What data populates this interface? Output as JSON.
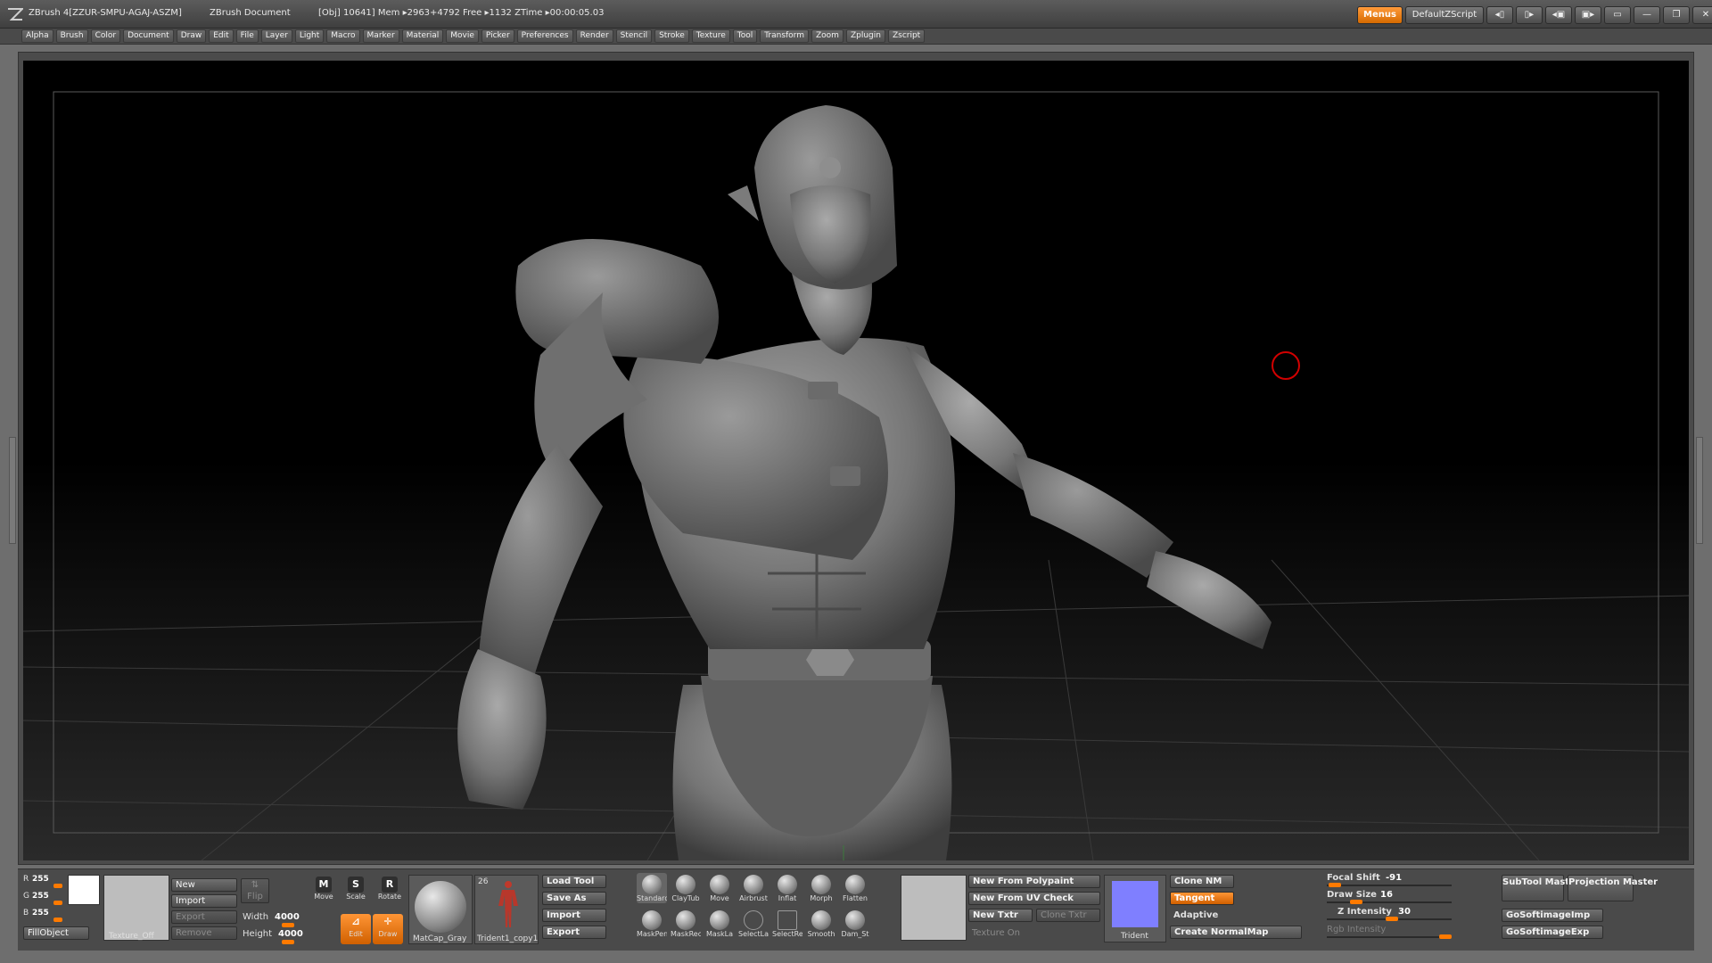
{
  "titlebar": {
    "app": "ZBrush 4[ZZUR-SMPU-AGAJ-ASZM]",
    "document": "ZBrush Document",
    "stats": "[Obj] 10641]  Mem ▸2963+4792  Free ▸1132  ZTime ▸00:00:05.03",
    "menus_toggle": "Menus",
    "default_script": "DefaultZScript"
  },
  "menubar": [
    "Alpha",
    "Brush",
    "Color",
    "Document",
    "Draw",
    "Edit",
    "File",
    "Layer",
    "Light",
    "Macro",
    "Marker",
    "Material",
    "Movie",
    "Picker",
    "Preferences",
    "Render",
    "Stencil",
    "Stroke",
    "Texture",
    "Tool",
    "Transform",
    "Zoom",
    "Zplugin",
    "Zscript"
  ],
  "color": {
    "r_label": "R",
    "r_value": "255",
    "g_label": "G",
    "g_value": "255",
    "b_label": "B",
    "b_value": "255",
    "fill_object": "FillObject"
  },
  "texture_panel": {
    "new": "New",
    "import": "Import",
    "export": "Export",
    "remove": "Remove",
    "texture_off": "Texture_Off",
    "flip": "Flip",
    "width_label": "Width",
    "width_value": "4000",
    "height_label": "Height",
    "height_value": "4000"
  },
  "transform": {
    "move": "Move",
    "scale": "Scale",
    "rotate": "Rotate",
    "edit": "Edit",
    "draw": "Draw"
  },
  "material": {
    "name": "MatCap_Gray"
  },
  "tool": {
    "name": "Trident1_copy1",
    "count": "26"
  },
  "tool_buttons": {
    "load": "Load Tool",
    "save_as": "Save As",
    "import": "Import",
    "export": "Export"
  },
  "brushes": [
    "Standard",
    "ClayTub",
    "Move",
    "Airbrust",
    "Inflat",
    "Morph",
    "Flatten",
    "MaskPen",
    "MaskRec",
    "MaskLa",
    "SelectLa",
    "SelectRe",
    "Smooth",
    "Dam_St"
  ],
  "polypaint": {
    "new_from_polypaint": "New From Polypaint",
    "new_from_uv_check": "New From UV Check",
    "new_txtr": "New Txtr",
    "clone_txtr": "Clone Txtr",
    "texture_on": "Texture On"
  },
  "normalmap": {
    "thumb_label": "Trident",
    "clone_nm": "Clone NM",
    "tangent": "Tangent",
    "adaptive": "Adaptive",
    "create_normalmap": "Create NormalMap"
  },
  "draw_settings": {
    "focal_shift_label": "Focal Shift",
    "focal_shift_value": "-91",
    "draw_size_label": "Draw Size",
    "draw_size_value": "16",
    "z_intensity_label": "Z Intensity",
    "z_intensity_value": "30",
    "rgb_intensity_label": "Rgb Intensity"
  },
  "plugins": {
    "subtool_master": "SubTool Master",
    "projection_master": "Projection Master",
    "gosoftimage_imp": "GoSoftimageImp",
    "gosoftimage_exp": "GoSoftimageExp"
  },
  "colors": {
    "accent": "#ff7a00",
    "canvas": "#000000",
    "panel": "#4a4a4a"
  }
}
